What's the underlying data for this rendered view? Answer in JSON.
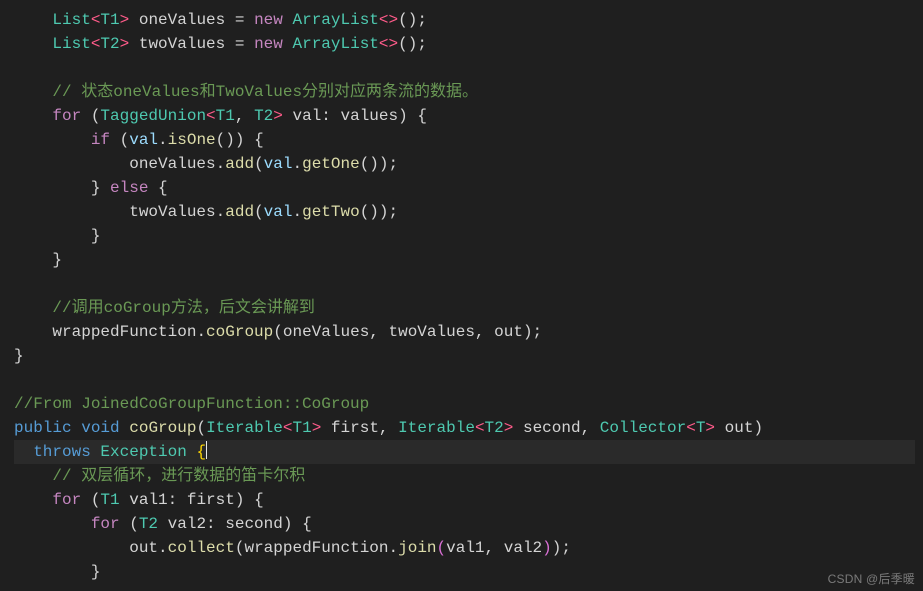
{
  "theme": {
    "bg": "#1f1f1f",
    "fg": "#d4d4d4",
    "keyword": "#569cd6",
    "control": "#c586c0",
    "type": "#4ec9b0",
    "angle": "#ff5b8a",
    "function": "#dcdcaa",
    "comment": "#6a9955",
    "brace_hl": "#ffd700",
    "paren_alt": "#da70d6"
  },
  "font": "Consolas",
  "line_height_px": 24,
  "cursor": {
    "line_index": 18,
    "after_token": "{"
  },
  "code_lines": [
    [
      {
        "cls": "c-ws",
        "t": "    "
      },
      {
        "cls": "c-type",
        "t": "List"
      },
      {
        "cls": "c-ang",
        "t": "<"
      },
      {
        "cls": "c-gen",
        "t": "T1"
      },
      {
        "cls": "c-ang",
        "t": ">"
      },
      {
        "cls": "c-ws",
        "t": " "
      },
      {
        "cls": "c-id",
        "t": "oneValues "
      },
      {
        "cls": "c-ws",
        "t": "= "
      },
      {
        "cls": "c-new",
        "t": "new"
      },
      {
        "cls": "c-ws",
        "t": " "
      },
      {
        "cls": "c-type",
        "t": "ArrayList"
      },
      {
        "cls": "c-ang",
        "t": "<>"
      },
      {
        "cls": "c-ws",
        "t": "();"
      }
    ],
    [
      {
        "cls": "c-ws",
        "t": "    "
      },
      {
        "cls": "c-type",
        "t": "List"
      },
      {
        "cls": "c-ang",
        "t": "<"
      },
      {
        "cls": "c-gen",
        "t": "T2"
      },
      {
        "cls": "c-ang",
        "t": ">"
      },
      {
        "cls": "c-ws",
        "t": " "
      },
      {
        "cls": "c-id",
        "t": "twoValues "
      },
      {
        "cls": "c-ws",
        "t": "= "
      },
      {
        "cls": "c-new",
        "t": "new"
      },
      {
        "cls": "c-ws",
        "t": " "
      },
      {
        "cls": "c-type",
        "t": "ArrayList"
      },
      {
        "cls": "c-ang",
        "t": "<>"
      },
      {
        "cls": "c-ws",
        "t": "();"
      }
    ],
    [],
    [
      {
        "cls": "c-ws",
        "t": "    "
      },
      {
        "cls": "c-cmt",
        "t": "// 状态oneValues和TwoValues分别对应两条流的数据。"
      }
    ],
    [
      {
        "cls": "c-ws",
        "t": "    "
      },
      {
        "cls": "c-ctrl",
        "t": "for"
      },
      {
        "cls": "c-ws",
        "t": " ("
      },
      {
        "cls": "c-type",
        "t": "TaggedUnion"
      },
      {
        "cls": "c-ang",
        "t": "<"
      },
      {
        "cls": "c-gen",
        "t": "T1"
      },
      {
        "cls": "c-ws",
        "t": ", "
      },
      {
        "cls": "c-gen",
        "t": "T2"
      },
      {
        "cls": "c-ang",
        "t": ">"
      },
      {
        "cls": "c-ws",
        "t": " "
      },
      {
        "cls": "c-id",
        "t": "val"
      },
      {
        "cls": "c-ws",
        "t": ": "
      },
      {
        "cls": "c-id",
        "t": "values"
      },
      {
        "cls": "c-ws",
        "t": ") {"
      }
    ],
    [
      {
        "cls": "c-ws",
        "t": "        "
      },
      {
        "cls": "c-ctrl",
        "t": "if"
      },
      {
        "cls": "c-ws",
        "t": " ("
      },
      {
        "cls": "c-var",
        "t": "val"
      },
      {
        "cls": "c-ws",
        "t": "."
      },
      {
        "cls": "c-fn",
        "t": "isOne"
      },
      {
        "cls": "c-ws",
        "t": "()) {"
      }
    ],
    [
      {
        "cls": "c-ws",
        "t": "            "
      },
      {
        "cls": "c-id",
        "t": "oneValues"
      },
      {
        "cls": "c-ws",
        "t": "."
      },
      {
        "cls": "c-fn",
        "t": "add"
      },
      {
        "cls": "c-ws",
        "t": "("
      },
      {
        "cls": "c-var",
        "t": "val"
      },
      {
        "cls": "c-ws",
        "t": "."
      },
      {
        "cls": "c-fn",
        "t": "getOne"
      },
      {
        "cls": "c-ws",
        "t": "());"
      }
    ],
    [
      {
        "cls": "c-ws",
        "t": "        } "
      },
      {
        "cls": "c-ctrl",
        "t": "else"
      },
      {
        "cls": "c-ws",
        "t": " {"
      }
    ],
    [
      {
        "cls": "c-ws",
        "t": "            "
      },
      {
        "cls": "c-id",
        "t": "twoValues"
      },
      {
        "cls": "c-ws",
        "t": "."
      },
      {
        "cls": "c-fn",
        "t": "add"
      },
      {
        "cls": "c-ws",
        "t": "("
      },
      {
        "cls": "c-var",
        "t": "val"
      },
      {
        "cls": "c-ws",
        "t": "."
      },
      {
        "cls": "c-fn",
        "t": "getTwo"
      },
      {
        "cls": "c-ws",
        "t": "());"
      }
    ],
    [
      {
        "cls": "c-ws",
        "t": "        }"
      }
    ],
    [
      {
        "cls": "c-ws",
        "t": "    }"
      }
    ],
    [],
    [
      {
        "cls": "c-ws",
        "t": "    "
      },
      {
        "cls": "c-cmt",
        "t": "//调用coGroup方法，后文会讲解到"
      }
    ],
    [
      {
        "cls": "c-ws",
        "t": "    "
      },
      {
        "cls": "c-id",
        "t": "wrappedFunction"
      },
      {
        "cls": "c-ws",
        "t": "."
      },
      {
        "cls": "c-fn",
        "t": "coGroup"
      },
      {
        "cls": "c-ws",
        "t": "("
      },
      {
        "cls": "c-id",
        "t": "oneValues"
      },
      {
        "cls": "c-ws",
        "t": ", "
      },
      {
        "cls": "c-id",
        "t": "twoValues"
      },
      {
        "cls": "c-ws",
        "t": ", "
      },
      {
        "cls": "c-id",
        "t": "out"
      },
      {
        "cls": "c-ws",
        "t": ");"
      }
    ],
    [
      {
        "cls": "c-ws",
        "t": "}"
      }
    ],
    [],
    [
      {
        "cls": "c-cmt",
        "t": "//From JoinedCoGroupFunction::CoGroup"
      }
    ],
    [
      {
        "cls": "c-kw",
        "t": "public"
      },
      {
        "cls": "c-ws",
        "t": " "
      },
      {
        "cls": "c-kw",
        "t": "void"
      },
      {
        "cls": "c-ws",
        "t": " "
      },
      {
        "cls": "c-fn",
        "t": "coGroup"
      },
      {
        "cls": "c-ws",
        "t": "("
      },
      {
        "cls": "c-type",
        "t": "Iterable"
      },
      {
        "cls": "c-ang",
        "t": "<"
      },
      {
        "cls": "c-gen",
        "t": "T1"
      },
      {
        "cls": "c-ang",
        "t": ">"
      },
      {
        "cls": "c-ws",
        "t": " "
      },
      {
        "cls": "c-id",
        "t": "first"
      },
      {
        "cls": "c-ws",
        "t": ", "
      },
      {
        "cls": "c-type",
        "t": "Iterable"
      },
      {
        "cls": "c-ang",
        "t": "<"
      },
      {
        "cls": "c-gen",
        "t": "T2"
      },
      {
        "cls": "c-ang",
        "t": ">"
      },
      {
        "cls": "c-ws",
        "t": " "
      },
      {
        "cls": "c-id",
        "t": "second"
      },
      {
        "cls": "c-ws",
        "t": ", "
      },
      {
        "cls": "c-type",
        "t": "Collector"
      },
      {
        "cls": "c-ang",
        "t": "<"
      },
      {
        "cls": "c-gen",
        "t": "T"
      },
      {
        "cls": "c-ang",
        "t": ">"
      },
      {
        "cls": "c-ws",
        "t": " "
      },
      {
        "cls": "c-id",
        "t": "out"
      },
      {
        "cls": "c-ws",
        "t": ")"
      }
    ],
    [
      {
        "cls": "c-ws",
        "t": "  "
      },
      {
        "cls": "c-kw",
        "t": "throws"
      },
      {
        "cls": "c-ws",
        "t": " "
      },
      {
        "cls": "c-type",
        "t": "Exception"
      },
      {
        "cls": "c-ws",
        "t": " "
      },
      {
        "cls": "c-br",
        "t": "{"
      },
      {
        "cls": "cursor",
        "t": ""
      }
    ],
    [
      {
        "cls": "c-ws",
        "t": "    "
      },
      {
        "cls": "c-cmt",
        "t": "// 双层循环，进行数据的笛卡尔积"
      }
    ],
    [
      {
        "cls": "c-ws",
        "t": "    "
      },
      {
        "cls": "c-ctrl",
        "t": "for"
      },
      {
        "cls": "c-ws",
        "t": " ("
      },
      {
        "cls": "c-gen",
        "t": "T1"
      },
      {
        "cls": "c-ws",
        "t": " "
      },
      {
        "cls": "c-id",
        "t": "val1"
      },
      {
        "cls": "c-ws",
        "t": ": "
      },
      {
        "cls": "c-id",
        "t": "first"
      },
      {
        "cls": "c-ws",
        "t": ") {"
      }
    ],
    [
      {
        "cls": "c-ws",
        "t": "        "
      },
      {
        "cls": "c-ctrl",
        "t": "for"
      },
      {
        "cls": "c-ws",
        "t": " ("
      },
      {
        "cls": "c-gen",
        "t": "T2"
      },
      {
        "cls": "c-ws",
        "t": " "
      },
      {
        "cls": "c-id",
        "t": "val2"
      },
      {
        "cls": "c-ws",
        "t": ": "
      },
      {
        "cls": "c-id",
        "t": "second"
      },
      {
        "cls": "c-ws",
        "t": ") {"
      }
    ],
    [
      {
        "cls": "c-ws",
        "t": "            "
      },
      {
        "cls": "c-id",
        "t": "out"
      },
      {
        "cls": "c-ws",
        "t": "."
      },
      {
        "cls": "c-fn",
        "t": "collect"
      },
      {
        "cls": "c-ws",
        "t": "("
      },
      {
        "cls": "c-id",
        "t": "wrappedFunction"
      },
      {
        "cls": "c-ws",
        "t": "."
      },
      {
        "cls": "c-fn",
        "t": "join"
      },
      {
        "cls": "c-par",
        "t": "("
      },
      {
        "cls": "c-id",
        "t": "val1"
      },
      {
        "cls": "c-ws",
        "t": ", "
      },
      {
        "cls": "c-id",
        "t": "val2"
      },
      {
        "cls": "c-par",
        "t": ")"
      },
      {
        "cls": "c-ws",
        "t": ");"
      }
    ],
    [
      {
        "cls": "c-ws",
        "t": "        }"
      }
    ]
  ],
  "watermark": "CSDN @后季暖"
}
